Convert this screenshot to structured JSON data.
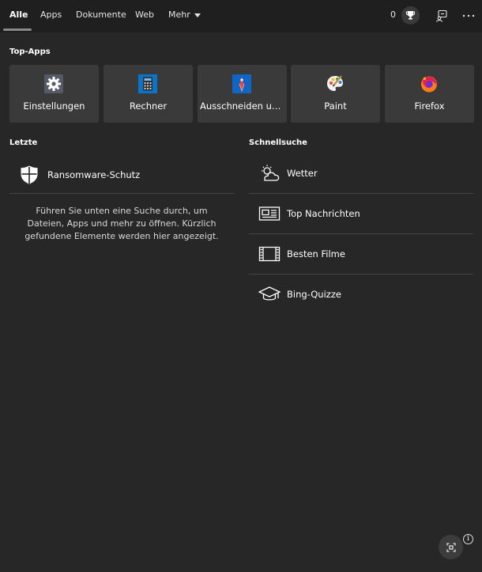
{
  "tabs": [
    {
      "label": "Alle",
      "active": true
    },
    {
      "label": "Apps"
    },
    {
      "label": "Dokumente"
    },
    {
      "label": "Web"
    },
    {
      "label": "Mehr"
    }
  ],
  "header": {
    "points": "0"
  },
  "top_apps": {
    "title": "Top-Apps",
    "items": [
      {
        "label": "Einstellungen",
        "icon": "gear-icon"
      },
      {
        "label": "Rechner",
        "icon": "calculator-icon"
      },
      {
        "label": "Ausschneiden un...",
        "icon": "snipping-tool-icon"
      },
      {
        "label": "Paint",
        "icon": "paint-palette-icon"
      },
      {
        "label": "Firefox",
        "icon": "firefox-icon"
      }
    ]
  },
  "recent": {
    "title": "Letzte",
    "items": [
      {
        "label": "Ransomware-Schutz",
        "icon": "shield-icon"
      }
    ],
    "hint": "Führen Sie unten eine Suche durch, um Dateien, Apps und mehr zu öffnen. Kürzlich gefundene Elemente werden hier angezeigt."
  },
  "quick_search": {
    "title": "Schnellsuche",
    "items": [
      {
        "label": "Wetter",
        "icon": "weather-icon"
      },
      {
        "label": "Top Nachrichten",
        "icon": "news-icon"
      },
      {
        "label": "Besten Filme",
        "icon": "film-icon"
      },
      {
        "label": "Bing-Quizze",
        "icon": "graduation-cap-icon"
      }
    ]
  },
  "colors": {
    "background": "#272727",
    "tile": "#3a3a3a",
    "topbar": "#1f1f1f"
  }
}
